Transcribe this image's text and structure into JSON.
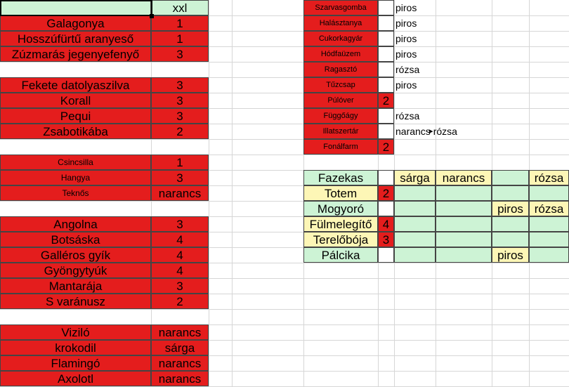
{
  "colors": {
    "red": "#e41d1d",
    "green": "#cdf3d5",
    "yellow": "#fdf6b6",
    "white": "#ffffff",
    "gridline": "#d6d6d6",
    "border": "#444444"
  },
  "left_block": {
    "header": {
      "name": "",
      "value": "xxl"
    },
    "rows": [
      {
        "name": "Galagonya",
        "value": "1"
      },
      {
        "name": "Hosszúfürtű aranyeső",
        "value": "1"
      },
      {
        "name": "Zúzmarás jegenyefenyő",
        "value": "3"
      },
      {
        "name": "Fekete datolyaszilva",
        "value": "3"
      },
      {
        "name": "Korall",
        "value": "3"
      },
      {
        "name": "Pequi",
        "value": "3"
      },
      {
        "name": "Zsabotikába",
        "value": "2"
      },
      {
        "name": "Csincsilla",
        "value": "1"
      },
      {
        "name": "Hangya",
        "value": "3"
      },
      {
        "name": "Teknős",
        "value": "narancs"
      },
      {
        "name": "Angolna",
        "value": "3"
      },
      {
        "name": "Botsáska",
        "value": "4"
      },
      {
        "name": "Galléros gyík",
        "value": "4"
      },
      {
        "name": "Gyöngytyúk",
        "value": "4"
      },
      {
        "name": "Mantarája",
        "value": "3"
      },
      {
        "name": "S varánusz",
        "value": "2"
      },
      {
        "name": "Viziló",
        "value": "narancs"
      },
      {
        "name": "krokodil",
        "value": "sárga"
      },
      {
        "name": "Flamingó",
        "value": "narancs"
      },
      {
        "name": "Axolotl",
        "value": "narancs"
      }
    ]
  },
  "right_top_block": {
    "rows": [
      {
        "name": "Szarvasgomba",
        "number": "",
        "color": "piros"
      },
      {
        "name": "Halásztanya",
        "number": "",
        "color": "piros"
      },
      {
        "name": "Cukorkagyár",
        "number": "",
        "color": "piros"
      },
      {
        "name": "Hódfaüzem",
        "number": "",
        "color": "piros"
      },
      {
        "name": "Ragasztó",
        "number": "",
        "color": "rózsa"
      },
      {
        "name": "Tűzcsap",
        "number": "",
        "color": "piros"
      },
      {
        "name": "Púlóver",
        "number": "2",
        "color": ""
      },
      {
        "name": "Függőágy",
        "number": "",
        "color": "rózsa"
      },
      {
        "name": "Illatszertár",
        "number": "",
        "color": "narancs rózsa"
      },
      {
        "name": "Fonálfarm",
        "number": "2",
        "color": ""
      }
    ]
  },
  "right_bottom_block": {
    "rows": [
      {
        "name": "Fazekas",
        "number": "",
        "c1": "sárga",
        "c2": "narancs",
        "c3": "",
        "c4": "rózsa"
      },
      {
        "name": "Totem",
        "number": "2",
        "c1": "",
        "c2": "",
        "c3": "",
        "c4": ""
      },
      {
        "name": "Mogyoró",
        "number": "",
        "c1": "",
        "c2": "",
        "c3": "piros",
        "c4": "rózsa"
      },
      {
        "name": "Fülmelegítő",
        "number": "4",
        "c1": "",
        "c2": "",
        "c3": "",
        "c4": ""
      },
      {
        "name": "Terelőbója",
        "number": "3",
        "c1": "",
        "c2": "",
        "c3": "",
        "c4": ""
      },
      {
        "name": "Pálcika",
        "number": "",
        "c1": "",
        "c2": "",
        "c3": "piros",
        "c4": ""
      }
    ]
  }
}
